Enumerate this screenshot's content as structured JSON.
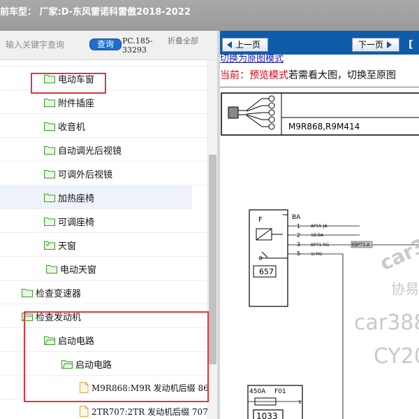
{
  "window": {
    "title": "前车型： 厂家:D-东风雷诺科雷傲2018-2022"
  },
  "search": {
    "placeholder": "输入关键字查询",
    "button_label": "查询",
    "pc_label": "PC.185-33293",
    "collapse_label": "折叠全部"
  },
  "tree": {
    "items": [
      {
        "label": "电动车窗",
        "type": "folder"
      },
      {
        "label": "附件插座",
        "type": "folder"
      },
      {
        "label": "收音机",
        "type": "folder"
      },
      {
        "label": "自动调光后视镜",
        "type": "folder"
      },
      {
        "label": "可调外后视镜",
        "type": "folder"
      },
      {
        "label": "加热座椅",
        "type": "folder",
        "selected": true
      },
      {
        "label": "可调座椅",
        "type": "folder"
      },
      {
        "label": "天窗",
        "type": "folder"
      },
      {
        "label": "电动天窗",
        "type": "folder"
      },
      {
        "label": "检查变速器",
        "type": "folder"
      },
      {
        "label": "检查发动机",
        "type": "folder"
      },
      {
        "label": "启动电路",
        "type": "folder"
      },
      {
        "label": "启动电路",
        "type": "folder"
      },
      {
        "label": "M9R868:M9R 发动机后缀 86",
        "type": "file"
      },
      {
        "label": "2TR707:2TR 发动机后缀 707",
        "type": "file"
      }
    ]
  },
  "viewer": {
    "prev_label": "上一页",
    "next_label": "下一页",
    "extra_glyph": "[",
    "switch_link": "切换为原图模式",
    "current_label": "当前：预览模式",
    "current_rest": "若需看大图，切换至原图",
    "connector_label": "M9R868,R9M414",
    "module_top_letter": "F",
    "module_top_number": "657",
    "ba_label": "BA",
    "pins": [
      {
        "num": "1",
        "wire": "AP15-JA"
      },
      {
        "num": "2",
        "wire": "1B-BA"
      },
      {
        "num": "3",
        "wire": "BP71-RG"
      },
      {
        "num": "5",
        "wire": "1I-RG"
      }
    ],
    "tag_label": "EBP71-A",
    "fuse_amp": "450A",
    "fuse_id": "F01",
    "fuse_number": "1033",
    "fuse_pin": "1",
    "watermark_1": "car3",
    "watermark_2": "协易",
    "watermark_3": "car388",
    "watermark_4": "CY20"
  },
  "colors": {
    "highlight_box": "#e0353b",
    "nav_bar": "#0f5caa",
    "search_button": "#1d6fcf",
    "folder_icon": "#3a9a2e",
    "current_label": "#e0000e"
  }
}
